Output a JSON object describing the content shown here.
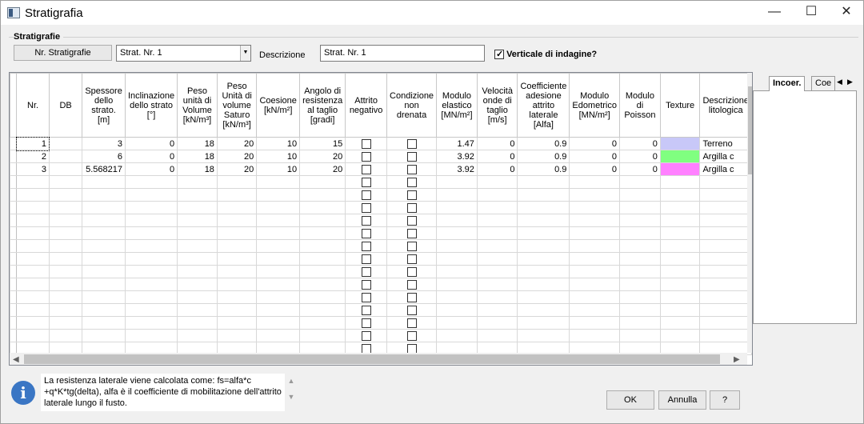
{
  "window": {
    "title": "Stratigrafia",
    "minimize": "—",
    "maximize": "☐",
    "close": "✕"
  },
  "group": {
    "label": "Stratigrafie"
  },
  "toolbar": {
    "nr_button": "Nr. Stratigrafie",
    "combo_value": "Strat. Nr. 1",
    "desc_label": "Descrizione",
    "desc_value": "Strat. Nr. 1",
    "vertical_label": "Verticale di indagine?",
    "vertical_checked": true
  },
  "grid": {
    "columns": [
      "Nr.",
      "DB",
      "Spessore dello strato. [m]",
      "Inclinazione dello strato [°]",
      "Peso unità di Volume [kN/m³]",
      "Peso Unità di volume Saturo [kN/m³]",
      "Coesione [kN/m²]",
      "Angolo di resistenza al taglio [gradi]",
      "Attrito negativo",
      "Condizione non drenata",
      "Modulo elastico [MN/m²]",
      "Velocità onde di taglio [m/s]",
      "Coefficiente adesione attrito laterale [Alfa]",
      "Modulo Edometrico [MN/m²]",
      "Modulo di Poisson",
      "Texture",
      "Descrizione litologica"
    ],
    "rows": [
      {
        "nr": "1",
        "db": "",
        "spessore": "3",
        "inclinazione": "0",
        "peso": "18",
        "peso_sat": "20",
        "coesione": "10",
        "angolo": "15",
        "modulo": "1.47",
        "velocita": "0",
        "alfa": "0.9",
        "edometrico": "0",
        "poisson": "0",
        "texture": "#c8c8f8",
        "descrizione": "Terreno"
      },
      {
        "nr": "2",
        "db": "",
        "spessore": "6",
        "inclinazione": "0",
        "peso": "18",
        "peso_sat": "20",
        "coesione": "10",
        "angolo": "20",
        "modulo": "3.92",
        "velocita": "0",
        "alfa": "0.9",
        "edometrico": "0",
        "poisson": "0",
        "texture": "#80ff80",
        "descrizione": "Argilla c"
      },
      {
        "nr": "3",
        "db": "",
        "spessore": "5.568217",
        "inclinazione": "0",
        "peso": "18",
        "peso_sat": "20",
        "coesione": "10",
        "angolo": "20",
        "modulo": "3.92",
        "velocita": "0",
        "alfa": "0.9",
        "edometrico": "0",
        "poisson": "0",
        "texture": "#ff80ff",
        "descrizione": "Argilla c"
      }
    ],
    "empty_rows": 14
  },
  "tabs": {
    "active": "Incoer.",
    "second": "Coe"
  },
  "info": {
    "text": "La resistenza laterale viene calcolata come: fs=alfa*c +q*K*tg(delta), alfa è il coefficiente di mobilitazione dell'attrito laterale lungo il fusto."
  },
  "buttons": {
    "ok": "OK",
    "annulla": "Annulla",
    "help": "?"
  }
}
